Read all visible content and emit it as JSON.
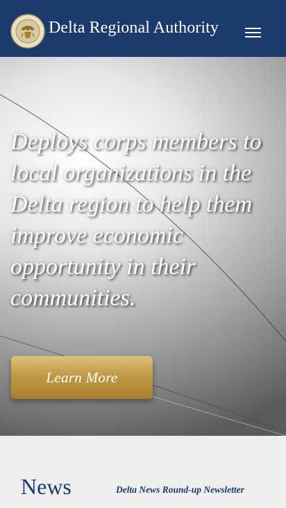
{
  "header": {
    "title": "Delta Regional Authority",
    "seal_text": "REGIONAL AUTHORITY",
    "menu_icon": "hamburger-menu-icon"
  },
  "hero": {
    "headline": "Deploys corps members to local organizations in the Delta region to help them improve economic opportunity in their communities.",
    "button_label": "Learn More"
  },
  "news": {
    "title": "News",
    "newsletter_link": "Delta News Round-up Newsletter"
  },
  "colors": {
    "navy": "#1c3a6b",
    "gold": "#c09a45",
    "white": "#ffffff",
    "light_gray": "#eeeeee"
  }
}
